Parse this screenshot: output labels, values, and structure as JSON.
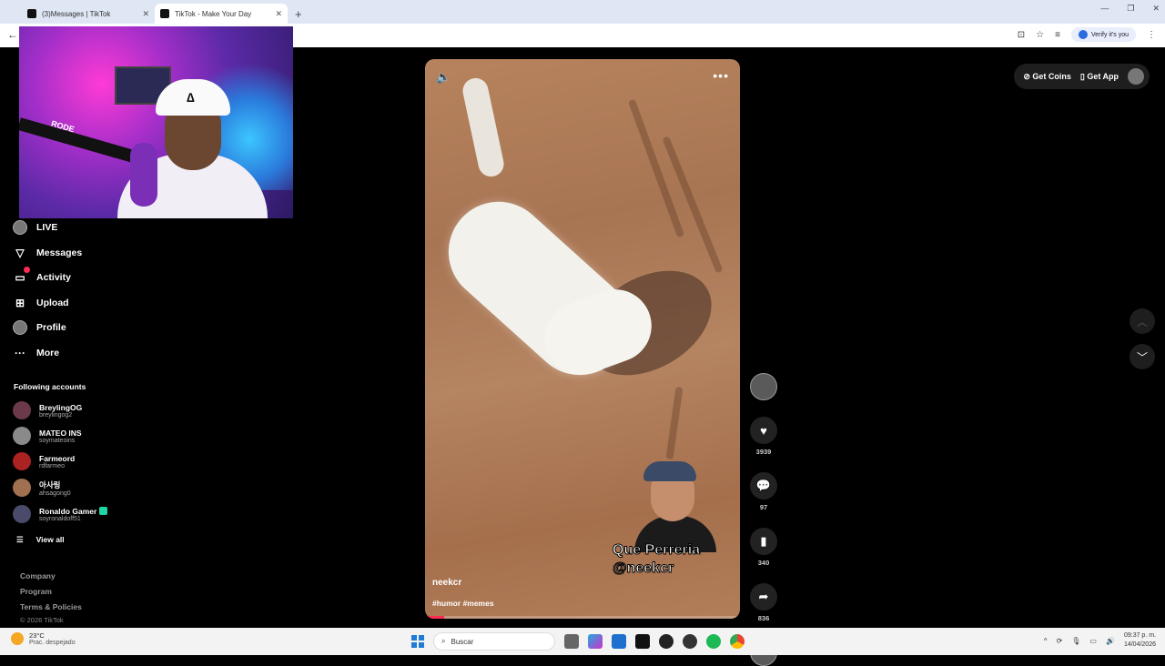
{
  "browser": {
    "tabs": [
      {
        "label": "(3)Messages | TikTok",
        "active": false
      },
      {
        "label": "TikTok - Make Your Day",
        "active": true
      }
    ],
    "verify_label": "Verify it's you"
  },
  "sidebar": {
    "items": [
      {
        "label": "LIVE",
        "icon": "live-avatar-icon"
      },
      {
        "label": "Messages",
        "icon": "messages-icon"
      },
      {
        "label": "Activity",
        "icon": "activity-icon",
        "badge": "3"
      },
      {
        "label": "Upload",
        "icon": "upload-icon"
      },
      {
        "label": "Profile",
        "icon": "profile-avatar-icon"
      },
      {
        "label": "More",
        "icon": "more-icon"
      }
    ],
    "following_title": "Following accounts",
    "accounts": [
      {
        "name": "BreylingOG",
        "handle": "breylingog2",
        "verified": false
      },
      {
        "name": "MATEO INS",
        "handle": "soymateoins",
        "verified": false
      },
      {
        "name": "Farmeord",
        "handle": "rdfarmeo",
        "verified": false
      },
      {
        "name": "아사링",
        "handle": "ahsagong0",
        "verified": false
      },
      {
        "name": "Ronaldo Gamer",
        "handle": "soyronaldoff51",
        "verified": true
      }
    ],
    "view_all": "View all",
    "footer_links": [
      "Company",
      "Program",
      "Terms & Policies"
    ],
    "copyright": "© 2026 TikTok"
  },
  "video": {
    "author": "neekcr",
    "tags": "#humor #memes",
    "overlay_caption_line1": "Que Perreria",
    "overlay_caption_line2": "@neekcr",
    "progress": 0.06
  },
  "actions": {
    "likes": "3939",
    "comments": "97",
    "saves": "340",
    "shares": "836"
  },
  "topright": {
    "coins": "Get Coins",
    "app": "Get App"
  },
  "taskbar": {
    "temp": "23°C",
    "weather": "Prac. despejado",
    "search": "Buscar",
    "time": "09:37 p. m.",
    "date": "14/04/2026"
  },
  "colors": {
    "accent": "#fe2c55",
    "sidebar_bg": "#000000",
    "button_bg": "#1e1e1e"
  }
}
